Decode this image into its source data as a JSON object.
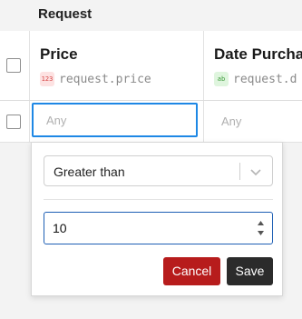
{
  "group": {
    "title": "Request"
  },
  "columns": [
    {
      "title": "Price",
      "type_icon": "number-type-icon",
      "type_glyph": "123",
      "field": "request.price"
    },
    {
      "title": "Date Purcha",
      "type_icon": "text-type-icon",
      "type_glyph": "ab",
      "field": "request.d"
    }
  ],
  "filters": {
    "price_placeholder": "Any",
    "date_placeholder": "Any"
  },
  "popup": {
    "operator": "Greater than",
    "value": "10",
    "cancel_label": "Cancel",
    "save_label": "Save"
  },
  "colors": {
    "focus": "#1e88e5",
    "cancel": "#b71c1c",
    "save": "#2b2b2b"
  }
}
